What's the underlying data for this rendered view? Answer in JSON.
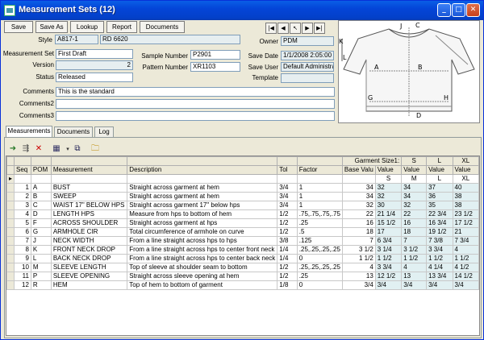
{
  "window": {
    "title": "Measurement Sets (12)"
  },
  "toolbar": {
    "save": "Save",
    "save_as": "Save As",
    "lookup": "Lookup",
    "report": "Report",
    "documents": "Documents"
  },
  "form": {
    "style_label": "Style",
    "style_code": "A817-1",
    "style_desc": "RD 6620",
    "owner_label": "Owner",
    "owner": "PDM",
    "mset_label": "Measurement Set",
    "mset": "First Draft",
    "version_label": "Version",
    "version": "2",
    "status_label": "Status",
    "status": "Released",
    "sample_label": "Sample Number",
    "sample": "P2901",
    "pattern_label": "Pattern Number",
    "pattern": "XR1103",
    "savedate_label": "Save Date",
    "savedate": "1/1/2008 2:05:00",
    "saveuser_label": "Save User",
    "saveuser": "Default Administra",
    "template_label": "Template",
    "template": "",
    "comments_label": "Comments",
    "comments": "This is the standard",
    "comments2_label": "Comments2",
    "comments2": "",
    "comments3_label": "Comments3",
    "comments3": ""
  },
  "tabs": [
    "Measurements",
    "Documents",
    "Log"
  ],
  "grid": {
    "group_header": "Garment Size1:",
    "sizes": [
      "S",
      "M",
      "L",
      "XL"
    ],
    "value_label": "Value",
    "columns": [
      "Seq",
      "POM",
      "Measurement",
      "Description",
      "Tol",
      "Factor",
      "Base Valu"
    ],
    "rows": [
      {
        "seq": "1",
        "pom": "A",
        "meas": "BUST",
        "desc": "Straight across garment at hem",
        "tol": "3/4",
        "factor": "1",
        "base": "34",
        "s": "32",
        "m": "34",
        "l": "37",
        "xl": "40"
      },
      {
        "seq": "2",
        "pom": "B",
        "meas": "SWEEP",
        "desc": "Straight across garment at hem",
        "tol": "3/4",
        "factor": "1",
        "base": "34",
        "s": "32",
        "m": "34",
        "l": "36",
        "xl": "38"
      },
      {
        "seq": "3",
        "pom": "C",
        "meas": "WAIST 17\" BELOW HPS",
        "desc": "Straight across garment 17\" below hps",
        "tol": "3/4",
        "factor": "1",
        "base": "32",
        "s": "30",
        "m": "32",
        "l": "35",
        "xl": "38"
      },
      {
        "seq": "4",
        "pom": "D",
        "meas": "LENGTH HPS",
        "desc": "Measure from hps to bottom of hem",
        "tol": "1/2",
        "factor": ".75,.75,.75,.75",
        "base": "22",
        "s": "21  1/4",
        "m": "22",
        "l": "22  3/4",
        "xl": "23  1/2"
      },
      {
        "seq": "5",
        "pom": "F",
        "meas": "ACROSS SHOULDER",
        "desc": "Straight across garment at hps",
        "tol": "1/2",
        "factor": ".25",
        "base": "16",
        "s": "15  1/2",
        "m": "16",
        "l": "16  3/4",
        "xl": "17  1/2"
      },
      {
        "seq": "6",
        "pom": "G",
        "meas": "ARMHOLE CIR",
        "desc": "Total circumference of armhole on curve",
        "tol": "1/2",
        "factor": ".5",
        "base": "18",
        "s": "17",
        "m": "18",
        "l": "19  1/2",
        "xl": "21"
      },
      {
        "seq": "7",
        "pom": "J",
        "meas": "NECK WIDTH",
        "desc": "From a line straight across hps to hps",
        "tol": "3/8",
        "factor": ".125",
        "base": "7",
        "s": "6  3/4",
        "m": "7",
        "l": "7  3/8",
        "xl": "7  3/4"
      },
      {
        "seq": "8",
        "pom": "K",
        "meas": "FRONT NECK DROP",
        "desc": "From a line straight across hps to center front neck",
        "tol": "1/4",
        "factor": ".25,.25,.25,.25",
        "base": "3  1/2",
        "s": "3  1/4",
        "m": "3  1/2",
        "l": "3  3/4",
        "xl": "4"
      },
      {
        "seq": "9",
        "pom": "L",
        "meas": "BACK NECK DROP",
        "desc": "From a line straight across hps to center back neck",
        "tol": "1/4",
        "factor": "0",
        "base": "1  1/2",
        "s": "1  1/2",
        "m": "1  1/2",
        "l": "1  1/2",
        "xl": "1  1/2"
      },
      {
        "seq": "10",
        "pom": "M",
        "meas": "SLEEVE LENGTH",
        "desc": "Top of sleeve at shoulder seam to bottom",
        "tol": "1/2",
        "factor": ".25,.25,.25,.25",
        "base": "4",
        "s": "3  3/4",
        "m": "4",
        "l": "4  1/4",
        "xl": "4  1/2"
      },
      {
        "seq": "11",
        "pom": "P",
        "meas": "SLEEVE OPENING",
        "desc": "Straight across sleeve opening at hem",
        "tol": "1/2",
        "factor": ".25",
        "base": "13",
        "s": "12  1/2",
        "m": "13",
        "l": "13  3/4",
        "xl": "14  1/2"
      },
      {
        "seq": "12",
        "pom": "R",
        "meas": "HEM",
        "desc": "Top of hem to bottom of garment",
        "tol": "1/8",
        "factor": "0",
        "base": "3/4",
        "s": "3/4",
        "m": "3/4",
        "l": "3/4",
        "xl": "3/4"
      }
    ]
  },
  "garment_letters": [
    "J",
    "C",
    "K",
    "L",
    "A",
    "B",
    "G",
    "H",
    "D"
  ]
}
